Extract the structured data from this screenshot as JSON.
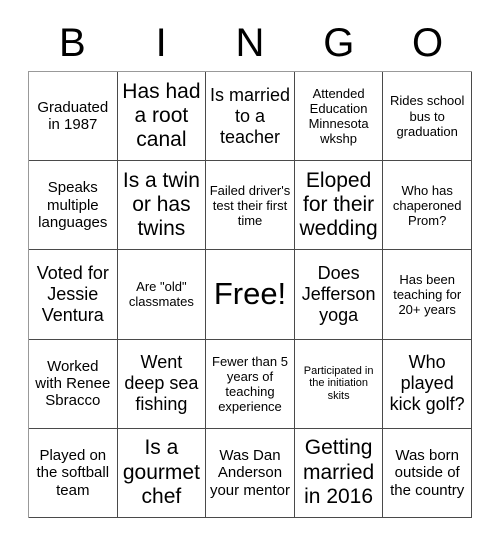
{
  "header": {
    "letters": [
      "B",
      "I",
      "N",
      "G",
      "O"
    ]
  },
  "grid": {
    "rows": 5,
    "columns": 5,
    "border_color": "#4a4a4a",
    "background_color": "#ffffff",
    "text_color": "#000000",
    "cells": [
      {
        "text": "Graduated in 1987",
        "size": "t-md",
        "free": false
      },
      {
        "text": "Has had a root canal",
        "size": "t-xl",
        "free": false
      },
      {
        "text": "Is married to a teacher",
        "size": "t-lg",
        "free": false
      },
      {
        "text": "Attended Education Minnesota wkshp",
        "size": "t-sm",
        "free": false
      },
      {
        "text": "Rides school bus to graduation",
        "size": "t-sm",
        "free": false
      },
      {
        "text": "Speaks multiple languages",
        "size": "t-md",
        "free": false
      },
      {
        "text": "Is a twin or has twins",
        "size": "t-xl",
        "free": false
      },
      {
        "text": "Failed driver's test their first time",
        "size": "t-sm",
        "free": false
      },
      {
        "text": "Eloped for their wedding",
        "size": "t-xl",
        "free": false
      },
      {
        "text": "Who has chaperoned Prom?",
        "size": "t-sm",
        "free": false
      },
      {
        "text": "Voted for Jessie Ventura",
        "size": "t-lg",
        "free": false
      },
      {
        "text": "Are \"old\" classmates",
        "size": "t-sm",
        "free": false
      },
      {
        "text": "Free!",
        "size": "t-free",
        "free": true
      },
      {
        "text": "Does Jefferson yoga",
        "size": "t-lg",
        "free": false
      },
      {
        "text": "Has been teaching for 20+ years",
        "size": "t-sm",
        "free": false
      },
      {
        "text": "Worked with Renee Sbracco",
        "size": "t-md",
        "free": false
      },
      {
        "text": "Went deep sea fishing",
        "size": "t-lg",
        "free": false
      },
      {
        "text": "Fewer than 5 years of teaching experience",
        "size": "t-sm",
        "free": false
      },
      {
        "text": "Participated in the initiation skits",
        "size": "t-xs",
        "free": false
      },
      {
        "text": "Who played kick golf?",
        "size": "t-lg",
        "free": false
      },
      {
        "text": "Played on the softball team",
        "size": "t-md",
        "free": false
      },
      {
        "text": "Is a gourmet chef",
        "size": "t-xl",
        "free": false
      },
      {
        "text": "Was Dan Anderson your mentor",
        "size": "t-md",
        "free": false
      },
      {
        "text": "Getting married in 2016",
        "size": "t-xl",
        "free": false
      },
      {
        "text": "Was born outside of the country",
        "size": "t-md",
        "free": false
      }
    ]
  }
}
